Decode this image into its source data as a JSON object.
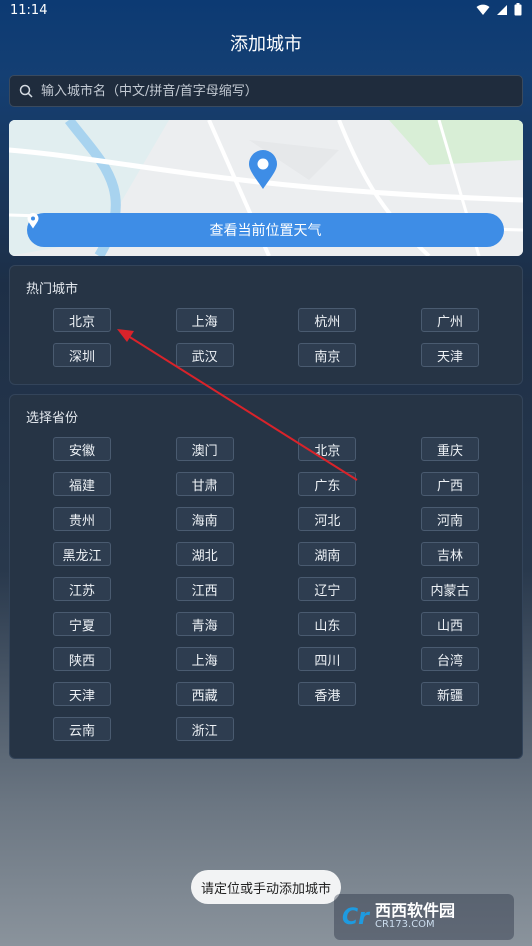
{
  "status": {
    "time": "11:14"
  },
  "header": {
    "title": "添加城市"
  },
  "search": {
    "placeholder": "输入城市名（中文/拼音/首字母缩写）"
  },
  "map": {
    "locate_label": "查看当前位置天气"
  },
  "hot_cities": {
    "title": "热门城市",
    "items": [
      "北京",
      "上海",
      "杭州",
      "广州",
      "深圳",
      "武汉",
      "南京",
      "天津"
    ]
  },
  "provinces": {
    "title": "选择省份",
    "items": [
      "安徽",
      "澳门",
      "北京",
      "重庆",
      "福建",
      "甘肃",
      "广东",
      "广西",
      "贵州",
      "海南",
      "河北",
      "河南",
      "黑龙江",
      "湖北",
      "湖南",
      "吉林",
      "江苏",
      "江西",
      "辽宁",
      "内蒙古",
      "宁夏",
      "青海",
      "山东",
      "山西",
      "陕西",
      "上海",
      "四川",
      "台湾",
      "天津",
      "西藏",
      "香港",
      "新疆",
      "云南",
      "浙江"
    ]
  },
  "toast": {
    "text": "请定位或手动添加城市"
  },
  "watermark": {
    "logo": "Cr",
    "name": "西西软件园",
    "site": "CR173.COM"
  },
  "colors": {
    "accent": "#3e8de6",
    "arrow": "#d9232a"
  }
}
